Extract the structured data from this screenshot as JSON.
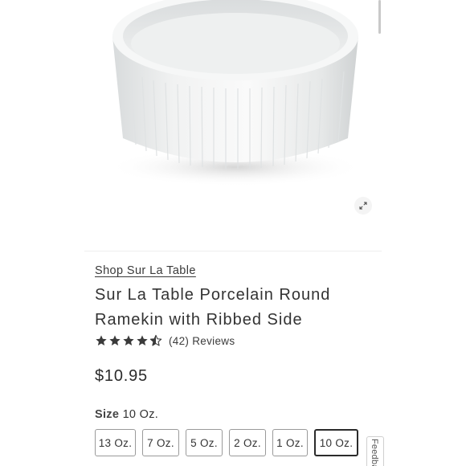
{
  "product": {
    "brand_link": "Shop Sur La Table",
    "title": "Sur La Table Porcelain Round Ramekin with Ribbed Side",
    "rating": 4.5,
    "reviews": "(42) Reviews",
    "price": "$10.95"
  },
  "size": {
    "label": "Size",
    "selected": "10 Oz.",
    "options": [
      "13 Oz.",
      "7 Oz.",
      "5 Oz.",
      "2 Oz.",
      "1 Oz.",
      "10 Oz."
    ]
  },
  "feedback": {
    "label": "Feedback"
  },
  "icons": {
    "expand": "expand-icon",
    "star": "star-icon"
  },
  "colors": {
    "text": "#333333",
    "star": "#3a3a3a",
    "selected_border": "#2b2b2b"
  }
}
